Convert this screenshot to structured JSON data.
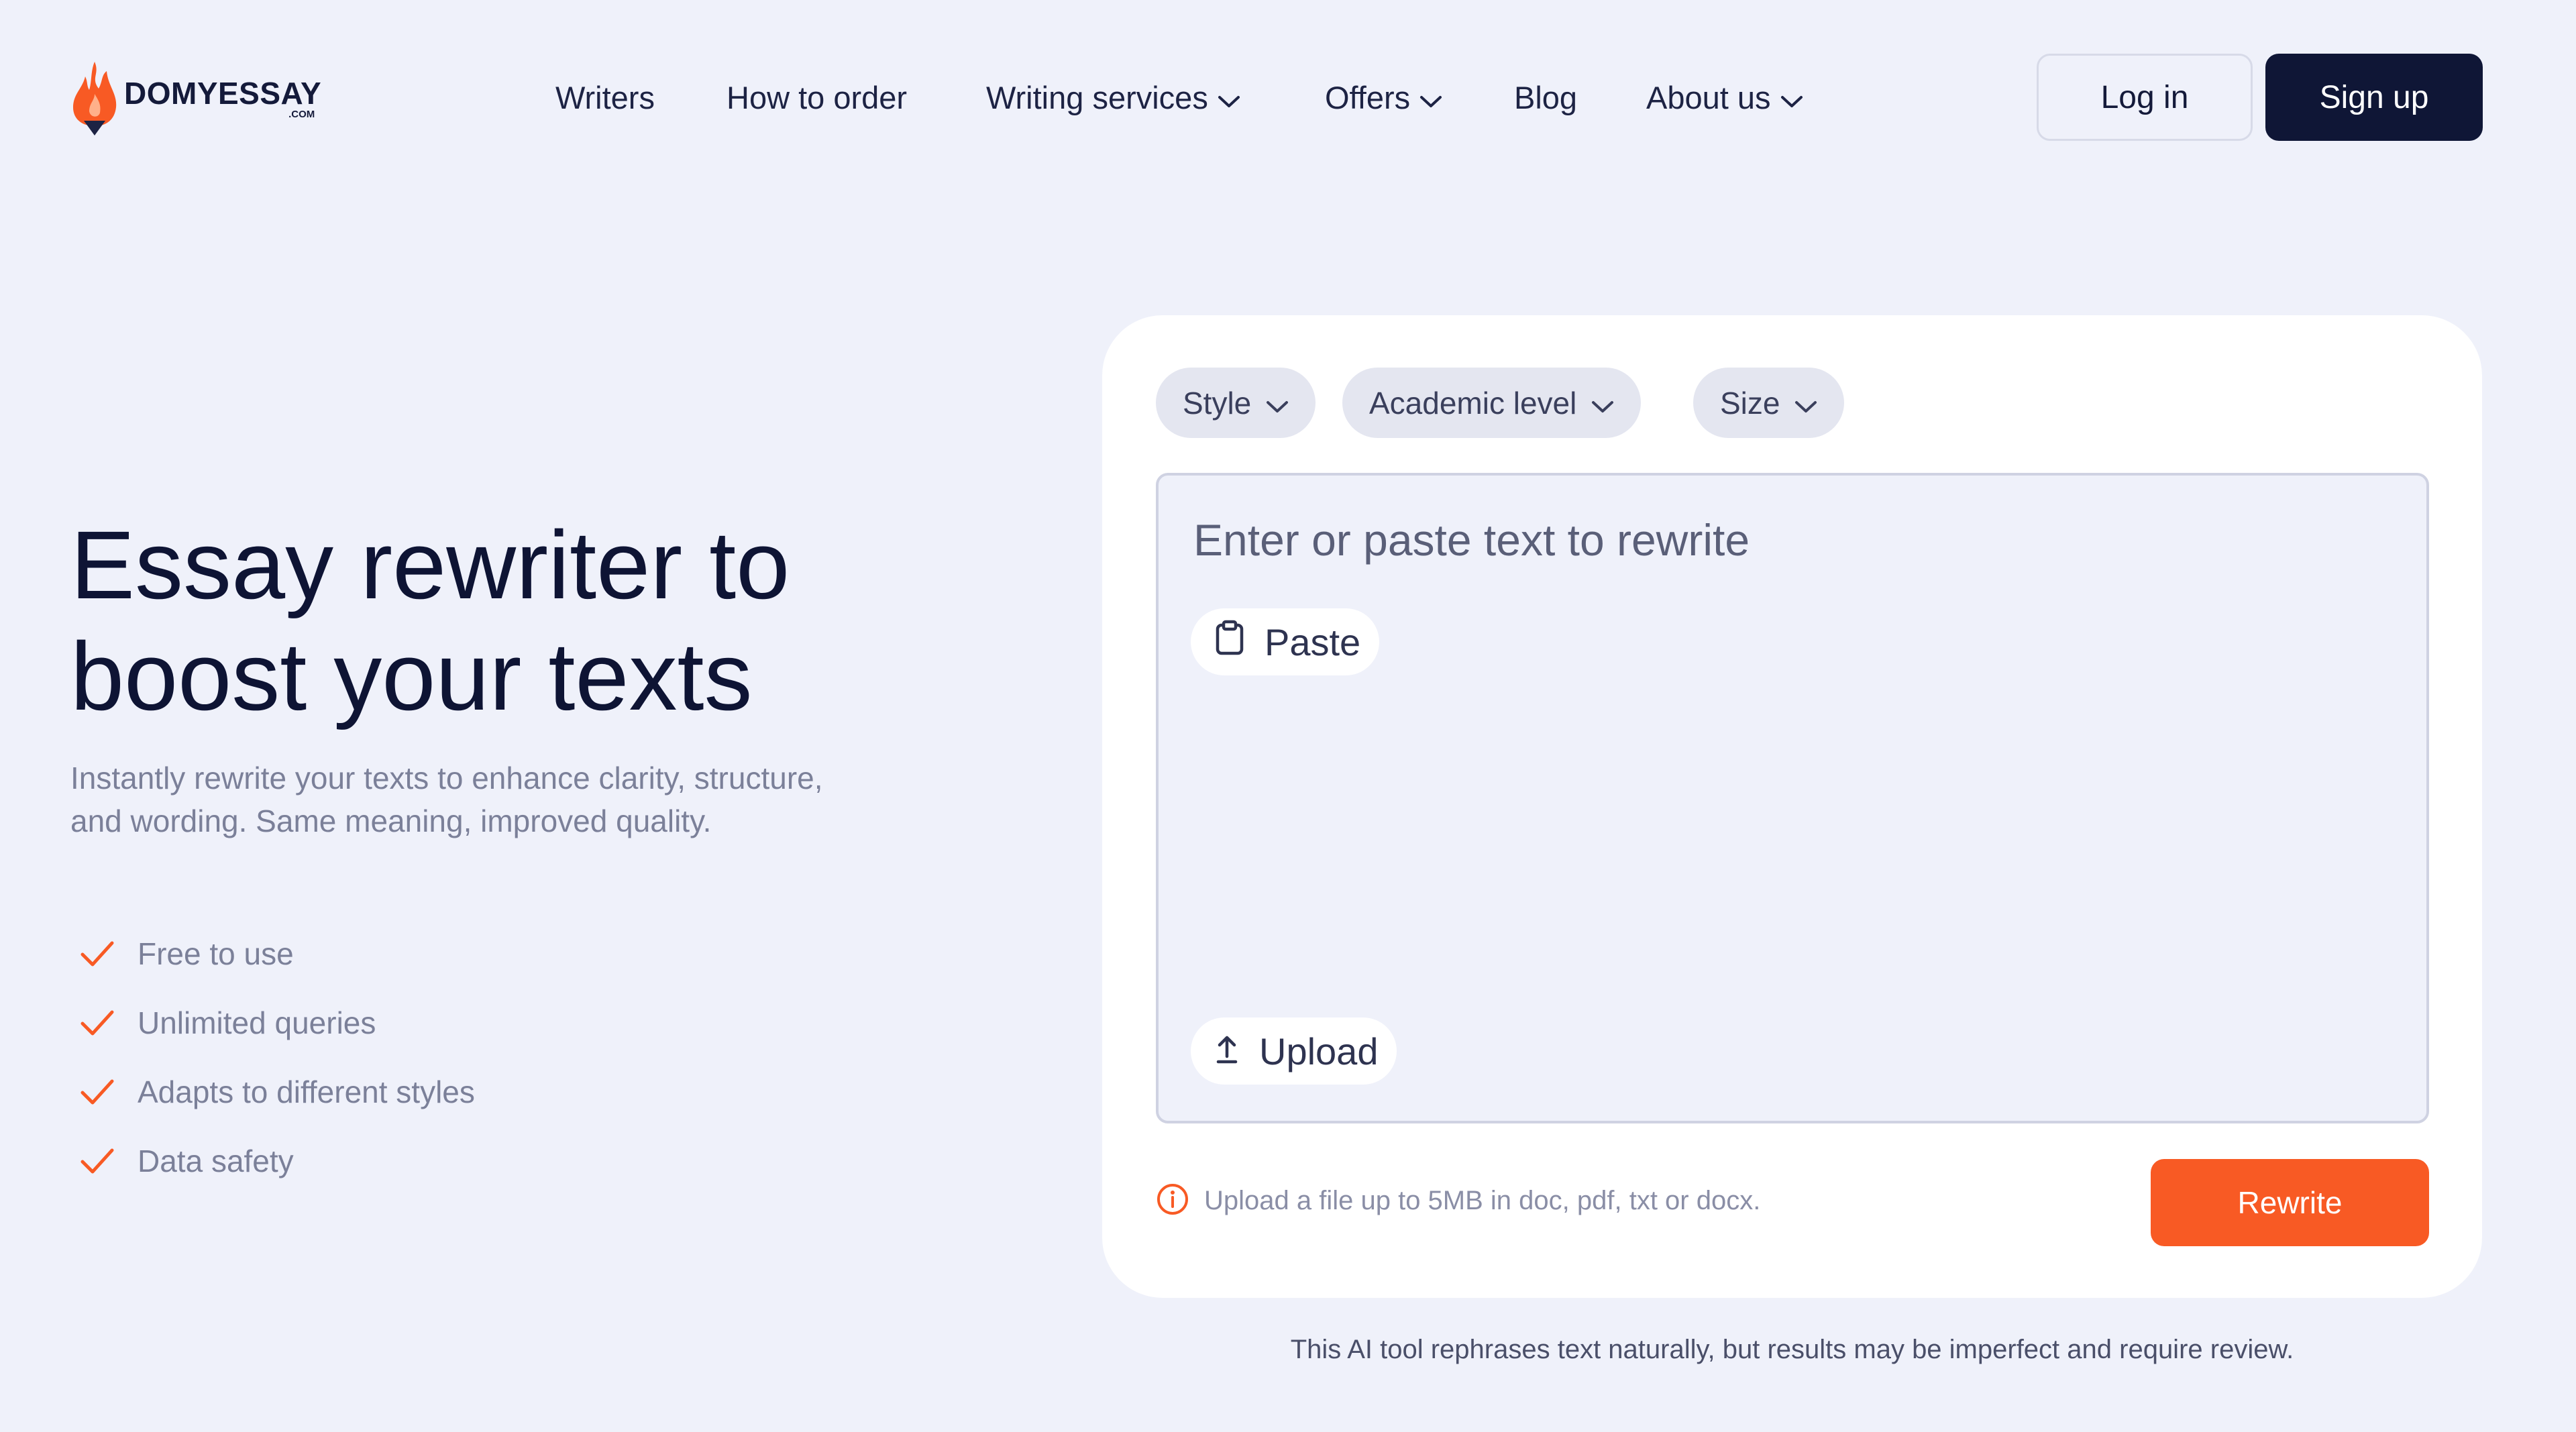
{
  "brand": {
    "name": "DOMYESSAY",
    "suffix": ".COM",
    "accent_color": "#f85a24",
    "dark_color": "#0f1636"
  },
  "nav": {
    "items": [
      {
        "label": "Writers",
        "has_dropdown": false
      },
      {
        "label": "How to order",
        "has_dropdown": false
      },
      {
        "label": "Writing services",
        "has_dropdown": true
      },
      {
        "label": "Offers",
        "has_dropdown": true
      },
      {
        "label": "Blog",
        "has_dropdown": false
      },
      {
        "label": "About us",
        "has_dropdown": true
      }
    ],
    "login_label": "Log in",
    "signup_label": "Sign up"
  },
  "hero": {
    "title_line1": "Essay rewriter to",
    "title_line2": "boost your texts",
    "description": "Instantly rewrite your texts to enhance clarity, structure, and wording. Same meaning, improved quality.",
    "features": [
      "Free to use",
      "Unlimited queries",
      "Adapts to different styles",
      "Data safety"
    ],
    "check_icon": "check-icon"
  },
  "tool": {
    "filters": [
      {
        "label": "Style"
      },
      {
        "label": "Academic level"
      },
      {
        "label": "Size"
      }
    ],
    "placeholder": "Enter or paste text to rewrite",
    "paste_label": "Paste",
    "upload_label": "Upload",
    "info_text": "Upload a file up to 5MB in doc, pdf, txt or docx.",
    "rewrite_label": "Rewrite"
  },
  "disclaimer": "This AI tool rephrases text naturally, but results may be imperfect and require review."
}
